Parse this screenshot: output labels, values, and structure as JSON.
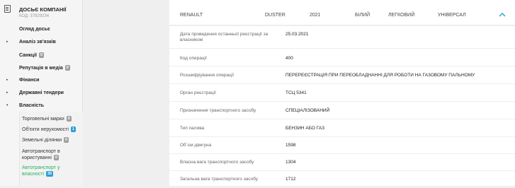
{
  "sidebar": {
    "company_title": "ДОСЬЄ КОМПАНІЇ",
    "company_code": "КОД: 37829234",
    "items": [
      {
        "label": "Огляд досьє",
        "arrow": "",
        "badge": ""
      },
      {
        "label": "Аналіз зв'язків",
        "arrow": "▸",
        "badge": ""
      },
      {
        "label": "Санкції",
        "arrow": "",
        "badge": "0"
      },
      {
        "label": "Репутація в медіа",
        "arrow": "",
        "badge": "0"
      },
      {
        "label": "Фінанси",
        "arrow": "▸",
        "badge": ""
      },
      {
        "label": "Державні тендери",
        "arrow": "▸",
        "badge": ""
      },
      {
        "label": "Власність",
        "arrow": "▾",
        "badge": ""
      }
    ],
    "subitems": [
      {
        "label": "Торговельні марки",
        "badge": "0"
      },
      {
        "label": "Об'єкти нерухомості",
        "badge": "1"
      },
      {
        "label": "Земельні ділянки",
        "badge": "0"
      },
      {
        "label_1": "Автотранспорт в",
        "label_2": "користуванні",
        "badge": "0"
      },
      {
        "label_1": "Автотранспорт у",
        "label_2": "власності",
        "badge": "35"
      }
    ]
  },
  "vehicle": {
    "brand": "RENAULT",
    "model": "DUSTER",
    "year": "2021",
    "color": "БІЛИЙ",
    "kind": "ЛЕГКОВИЙ",
    "body": "УНІВЕРСАЛ",
    "chevron_icon": "chevron-up-icon",
    "chevron_color": "#2a9fd6"
  },
  "details": [
    {
      "key_1": "Дата проведення останньої реєстрації за",
      "key_2": "власником",
      "value": "25.03.2021"
    },
    {
      "key": "Код операції",
      "value": "400"
    },
    {
      "key": "Розшифрування операції",
      "value": "ПЕРЕРЕЄСТРАЦІЯ ПРИ ПЕРЕОБЛАДНАННІ ДЛЯ РОБОТИ НА ГАЗОВОМУ ПАЛЬНОМУ"
    },
    {
      "key": "Орган реєстрації",
      "value": "ТСЦ 5341"
    },
    {
      "key": "Призначення транспортного засобу",
      "value": "СПЕЦІАЛІЗОВАНИЙ"
    },
    {
      "key": "Тип палива",
      "value": "БЕНЗИН АБО ГАЗ"
    },
    {
      "key": "Об`єм двигуна",
      "value": "1598"
    },
    {
      "key": "Власна вага транспортного засобу",
      "value": "1304"
    },
    {
      "key": "Загальна вага транспортного засобу",
      "value": "1712"
    }
  ]
}
